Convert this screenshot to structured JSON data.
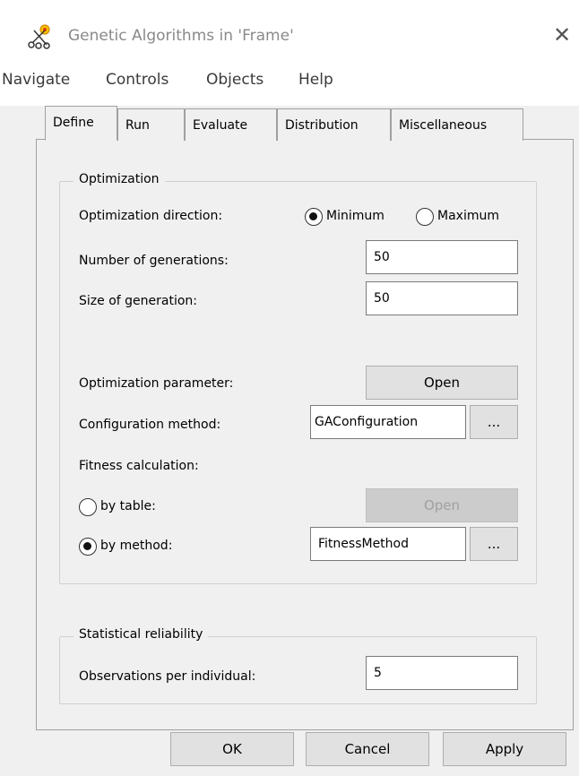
{
  "window": {
    "title": "Genetic Algorithms in 'Frame'",
    "close_glyph": "✕"
  },
  "menu": [
    "Navigate",
    "Controls",
    "Objects",
    "Help"
  ],
  "tabs": [
    "Define",
    "Run",
    "Evaluate",
    "Distribution",
    "Miscellaneous"
  ],
  "active_tab": "Define",
  "optimization": {
    "legend": "Optimization",
    "direction_label": "Optimization direction:",
    "direction_options": [
      "Minimum",
      "Maximum"
    ],
    "direction_selected": "Minimum",
    "generations_label": "Number of generations:",
    "generations_value": "50",
    "size_label": "Size of generation:",
    "size_value": "50",
    "param_label": "Optimization parameter:",
    "param_button": "Open",
    "config_label": "Configuration method:",
    "config_value": "GAConfiguration",
    "config_browse": "...",
    "fitness_label": "Fitness calculation:",
    "by_table_label": "by table:",
    "by_table_button": "Open",
    "by_method_label": "by method:",
    "by_method_value": "FitnessMethod",
    "by_method_browse": "...",
    "fitness_selected": "by method"
  },
  "reliability": {
    "legend": "Statistical reliability",
    "observations_label": "Observations per individual:",
    "observations_value": "5"
  },
  "footer": {
    "ok": "OK",
    "cancel": "Cancel",
    "apply": "Apply"
  }
}
